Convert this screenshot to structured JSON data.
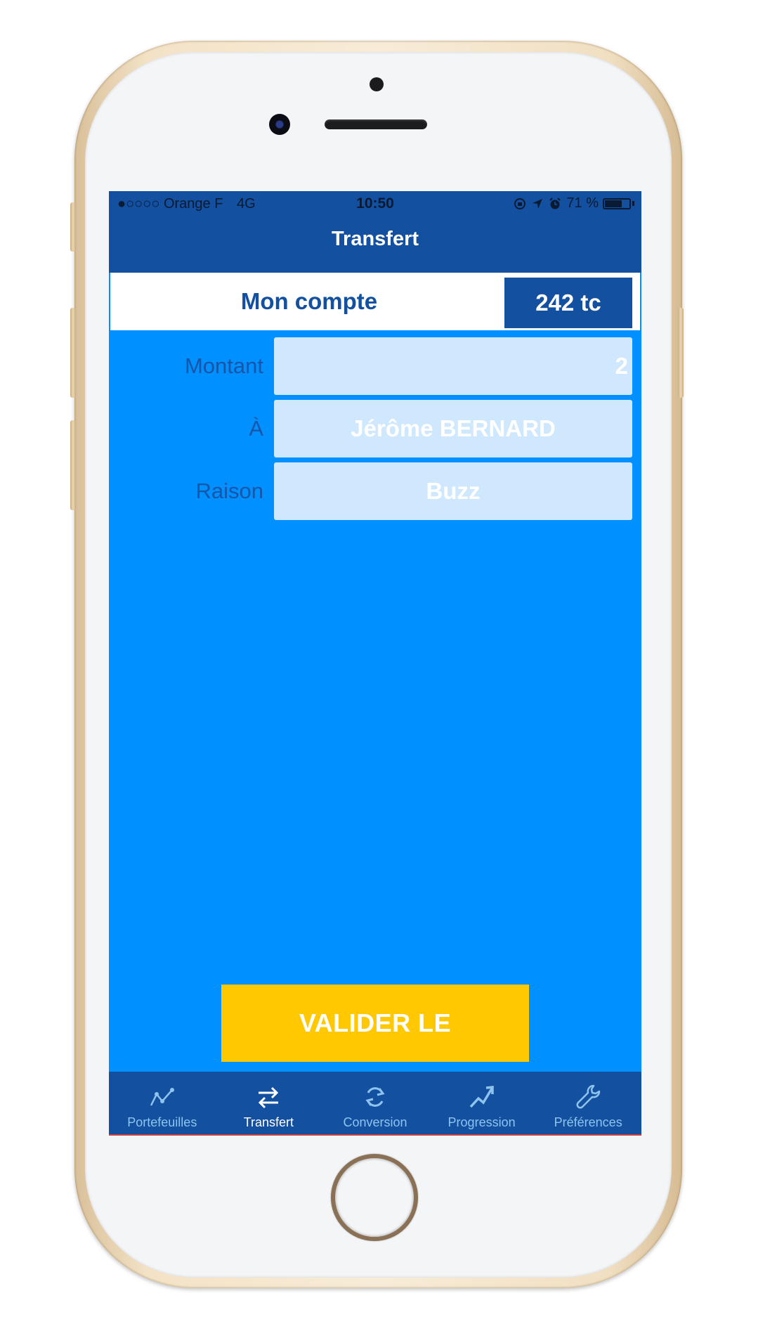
{
  "status_bar": {
    "carrier": "●○○○○ Orange F",
    "network": "4G",
    "time": "10:50",
    "battery_percent": "71 %",
    "battery_level": 0.71,
    "icons": [
      "orientation-lock-icon",
      "location-arrow-icon",
      "alarm-icon",
      "battery-icon"
    ]
  },
  "nav": {
    "title": "Transfert"
  },
  "account": {
    "label": "Mon compte",
    "balance": "242 tc"
  },
  "form": {
    "amount": {
      "label": "Montant",
      "value": "2"
    },
    "recipient": {
      "label": "À",
      "value": "Jérôme BERNARD"
    },
    "reason": {
      "label": "Raison",
      "value": "Buzz"
    }
  },
  "submit_label": "VALIDER LE TRANSFERT",
  "tabs": [
    {
      "label": "Portefeuilles",
      "icon": "chart-line-icon",
      "active": false
    },
    {
      "label": "Transfert",
      "icon": "transfer-arrows-icon",
      "active": true
    },
    {
      "label": "Conversion",
      "icon": "refresh-icon",
      "active": false
    },
    {
      "label": "Progression",
      "icon": "trending-up-icon",
      "active": false
    },
    {
      "label": "Préférences",
      "icon": "wrench-icon",
      "active": false
    }
  ],
  "colors": {
    "primary_dark": "#1350a0",
    "screen_blue": "#0090ff",
    "field_bg": "#cfe8fd",
    "button_yellow": "#ffc800",
    "tab_inactive": "#8ec4ee"
  }
}
